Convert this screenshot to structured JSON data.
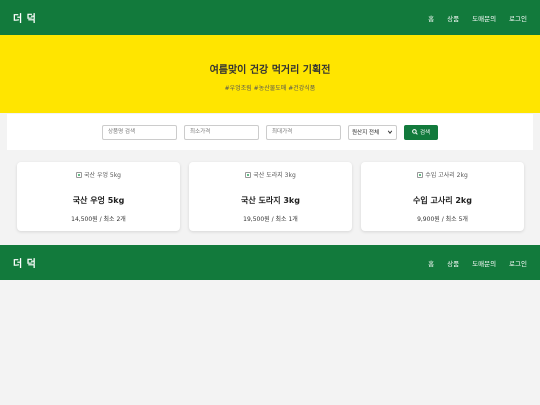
{
  "nav": {
    "brand": "더 덕",
    "links": [
      "홈",
      "상품",
      "도매문의",
      "로그인"
    ]
  },
  "hero": {
    "title": "여름맞이 건강 먹거리 기획전",
    "tags": "#우엉조림 #농산물도매 #건강식품"
  },
  "filters": {
    "name_placeholder": "상품명 검색",
    "min_placeholder": "최소가격",
    "max_placeholder": "최대가격",
    "origin_selected": "원산지 전체",
    "search_label": "검색"
  },
  "products": [
    {
      "image_alt": "국산 우엉 5kg",
      "name": "국산 우엉 5kg",
      "price": "14,500원",
      "min": "최소 2개"
    },
    {
      "image_alt": "국산 도라지 3kg",
      "name": "국산 도라지 3kg",
      "price": "19,500원",
      "min": "최소 1개"
    },
    {
      "image_alt": "수입 고사리 2kg",
      "name": "수입 고사리 2kg",
      "price": "9,900원",
      "min": "최소 5개"
    }
  ],
  "colors": {
    "nav_green": "#127a3c",
    "hero_yellow": "#ffe500",
    "page_bg": "#f3f3f3"
  },
  "icons": {
    "search": "search-icon",
    "broken_image": "broken-image-icon",
    "select_arrow": "chevron-down-icon"
  }
}
